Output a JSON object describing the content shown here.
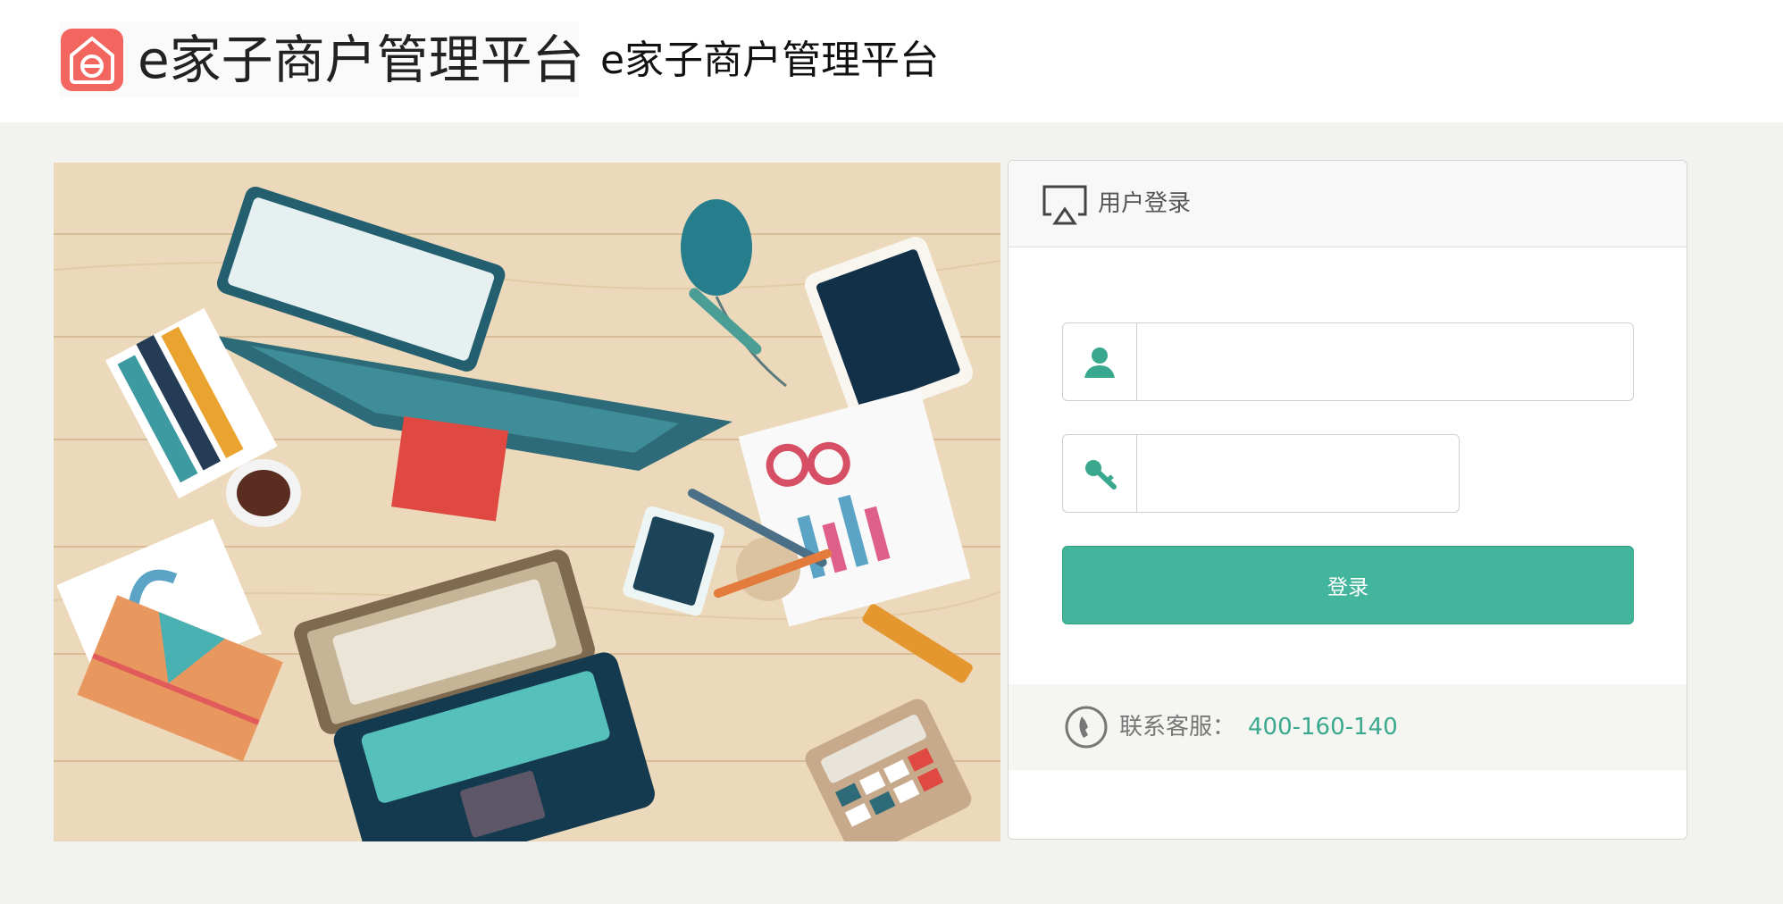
{
  "header": {
    "logo_text": "e家子商户管理平台",
    "site_title": "e家子商户管理平台"
  },
  "login": {
    "title": "用户登录",
    "username_placeholder": "",
    "password_placeholder": "",
    "submit_label": "登录"
  },
  "contact": {
    "label": "联系客服：",
    "phone": "400-160-140"
  },
  "colors": {
    "accent": "#44b59d",
    "logo": "#f2665f",
    "background": "#f2f2ef"
  }
}
